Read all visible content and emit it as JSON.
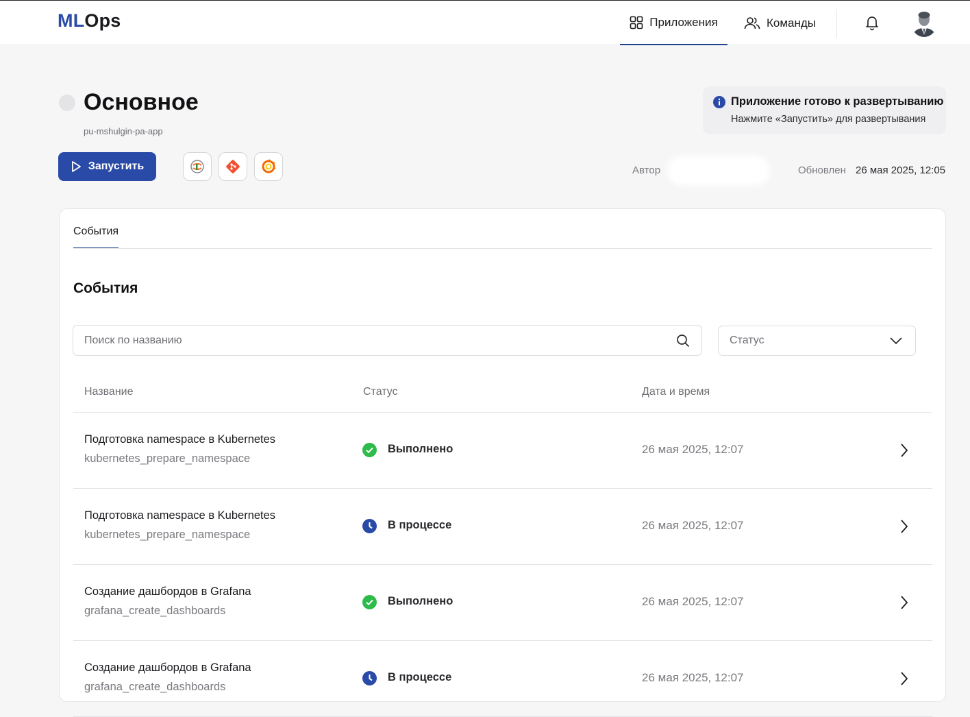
{
  "header": {
    "logo_ml": "ML",
    "logo_ops": "Ops",
    "nav": [
      {
        "label": "Приложения",
        "icon": "grid-icon",
        "active": true
      },
      {
        "label": "Команды",
        "icon": "users-icon",
        "active": false
      }
    ]
  },
  "page": {
    "title": "Основное",
    "subtitle": "pu-mshulgin-pa-app",
    "run_label": "Запустить",
    "tools": [
      "jupyter-icon",
      "git-icon",
      "grafana-icon"
    ],
    "notice": {
      "title": "Приложение готово к развертыванию",
      "text": "Нажмите «Запустить» для развертывания"
    },
    "author_label": "Автор",
    "updated_label": "Обновлен",
    "updated_value": "26 мая 2025, 12:05"
  },
  "events": {
    "tab_label": "События",
    "title": "События",
    "search_placeholder": "Поиск по названию",
    "status_placeholder": "Статус",
    "columns": [
      "Название",
      "Статус",
      "Дата и время"
    ],
    "rows": [
      {
        "name": "Подготовка namespace в Kubernetes",
        "code": "kubernetes_prepare_namespace",
        "status": "Выполнено",
        "date": "26 мая 2025, 12:07"
      },
      {
        "name": "Подготовка namespace в Kubernetes",
        "code": "kubernetes_prepare_namespace",
        "status": "В процессе",
        "date": "26 мая 2025, 12:07"
      },
      {
        "name": "Создание дашбордов в Grafana",
        "code": "grafana_create_dashboards",
        "status": "Выполнено",
        "date": "26 мая 2025, 12:07"
      },
      {
        "name": "Создание дашбордов в Grafana",
        "code": "grafana_create_dashboards",
        "status": "В процессе",
        "date": "26 мая 2025, 12:07"
      }
    ]
  },
  "colors": {
    "accent": "#2a4aa8",
    "success": "#2dbb4a",
    "in_progress": "#2a4aa8"
  }
}
